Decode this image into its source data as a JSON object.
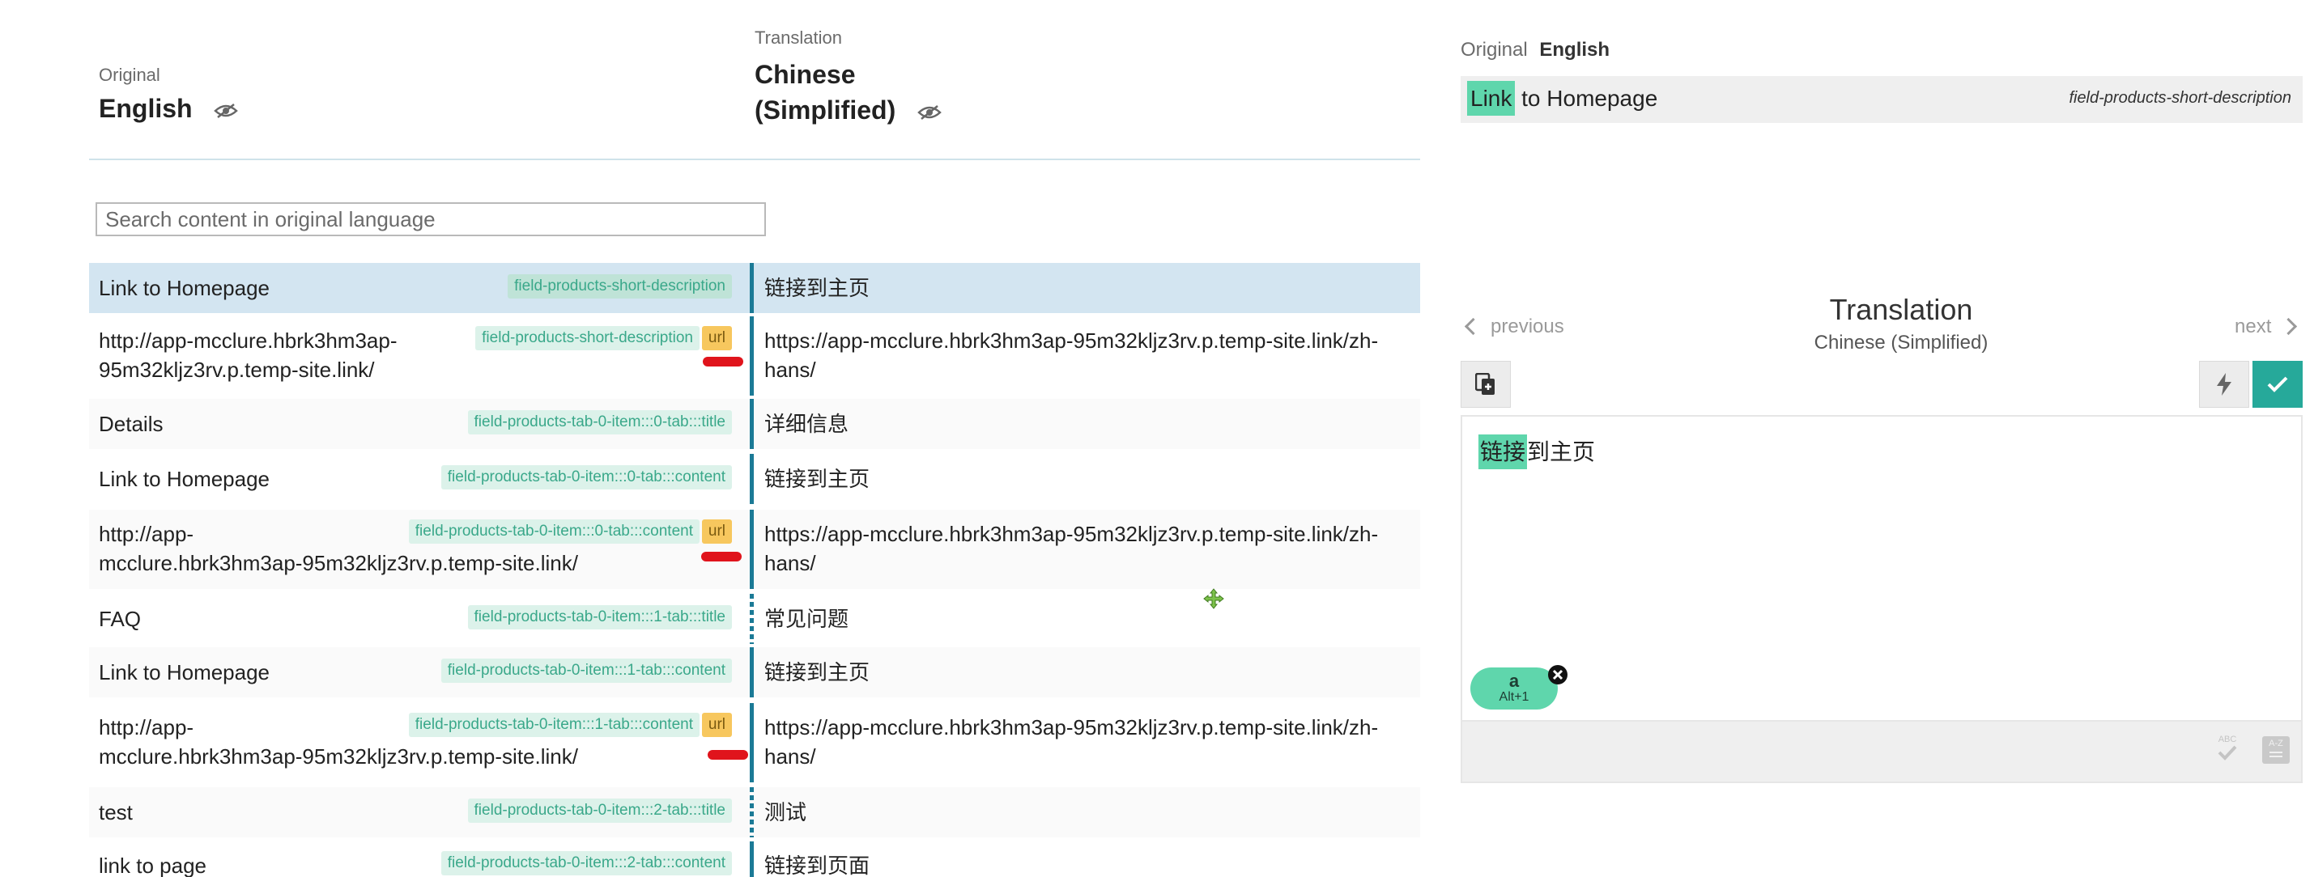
{
  "left_header": {
    "original_label": "Original",
    "original_language": "English",
    "translation_label": "Translation",
    "translation_language_line1": "Chinese",
    "translation_language_line2": "(Simplified)"
  },
  "search": {
    "placeholder": "Search content in original language",
    "value": ""
  },
  "rows": [
    {
      "original": "Link to Homepage",
      "field": "field-products-short-description",
      "url_badge": "",
      "translation": "链接到主页"
    },
    {
      "original_line1": "http://app-mcclure.hbrk3hm3ap-",
      "original_line2": "95m32kljz3rv.p.temp-site.link/",
      "field": "field-products-short-description",
      "url_badge": "url",
      "translation_line1": "https://app-mcclure.hbrk3hm3ap-95m32kljz3rv.p.temp-site.link/zh-",
      "translation_line2": "hans/"
    },
    {
      "original": "Details",
      "field": "field-products-tab-0-item:::0-tab:::title",
      "url_badge": "",
      "translation": "详细信息"
    },
    {
      "original": "Link to Homepage",
      "field": "field-products-tab-0-item:::0-tab:::content",
      "url_badge": "",
      "translation": "链接到主页"
    },
    {
      "original_line1": "http://app-",
      "original_line2": "mcclure.hbrk3hm3ap-95m32kljz3rv.p.temp-site.link/",
      "field": "field-products-tab-0-item:::0-tab:::content",
      "url_badge": "url",
      "translation_line1": "https://app-mcclure.hbrk3hm3ap-95m32kljz3rv.p.temp-site.link/zh-",
      "translation_line2": "hans/"
    },
    {
      "original": "FAQ",
      "field": "field-products-tab-0-item:::1-tab:::title",
      "url_badge": "",
      "translation": "常见问题"
    },
    {
      "original": "Link to Homepage",
      "field": "field-products-tab-0-item:::1-tab:::content",
      "url_badge": "",
      "translation": "链接到主页"
    },
    {
      "original_line1": "http://app-",
      "original_line2": "mcclure.hbrk3hm3ap-95m32kljz3rv.p.temp-site.link/",
      "field": "field-products-tab-0-item:::1-tab:::content",
      "url_badge": "url",
      "translation_line1": "https://app-mcclure.hbrk3hm3ap-95m32kljz3rv.p.temp-site.link/zh-",
      "translation_line2": "hans/"
    },
    {
      "original": "test",
      "field": "field-products-tab-0-item:::2-tab:::title",
      "url_badge": "",
      "translation": "测试"
    },
    {
      "original": "link to page",
      "field": "field-products-tab-0-item:::2-tab:::content",
      "url_badge": "",
      "translation": "链接到页面"
    }
  ],
  "right_panel": {
    "original_label": "Original",
    "original_language": "English",
    "source_highlight": "Link",
    "source_rest": " to Homepage",
    "source_field": "field-products-short-description",
    "previous_label": "previous",
    "next_label": "next",
    "translation_title": "Translation",
    "translation_language": "Chinese (Simplified)",
    "editor_highlight": "链接",
    "editor_rest": "到主页",
    "chip_letter": "a",
    "chip_shortcut": "Alt+1",
    "spellcheck_label": "ABC",
    "dictionary_label": "A-Z"
  },
  "colors": {
    "accent_teal": "#26a99a",
    "selected_row": "#d3e5f1",
    "field_tag_bg": "#dcf2ea",
    "url_badge_bg": "#f7c75e",
    "highlight_green": "#5fd6ac",
    "row_bar": "#1b7a96",
    "annotation_red": "#e0141c"
  },
  "icons": [
    "eye-slash-icon",
    "chevron-left-icon",
    "chevron-right-icon",
    "copy-source-icon",
    "lightning-icon",
    "check-icon",
    "close-icon",
    "move-cursor-icon",
    "spellcheck-icon",
    "dictionary-icon"
  ]
}
